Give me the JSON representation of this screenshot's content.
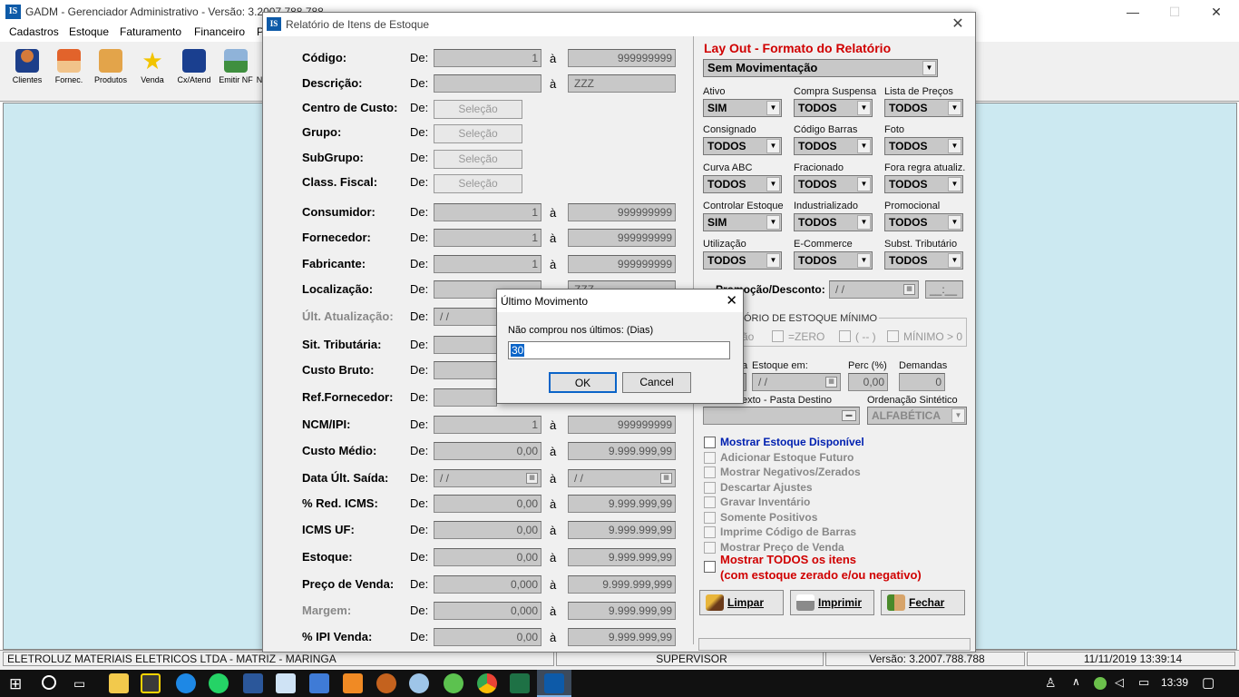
{
  "app": {
    "title": "GADM - Gerenciador Administrativo - Versão: 3.2007.788.788",
    "logo": "IS"
  },
  "menus": [
    "Cadastros",
    "Estoque",
    "Faturamento",
    "Financeiro",
    "P"
  ],
  "toolbar": [
    {
      "label": "Clientes",
      "icon": "person-icon"
    },
    {
      "label": "Fornec.",
      "icon": "house-icon"
    },
    {
      "label": "Produtos",
      "icon": "box-icon"
    },
    {
      "label": "Venda",
      "icon": "star-icon"
    },
    {
      "label": "Cx/Atend",
      "icon": "cash-icon"
    },
    {
      "label": "Emitir NF",
      "icon": "printer-icon"
    },
    {
      "label": "N",
      "icon": "partial-icon"
    }
  ],
  "statusbar": {
    "company": "ELETROLUZ MATERIAIS ELETRICOS LTDA  -  MATRIZ - MARINGA",
    "user": "SUPERVISOR",
    "version": "Versão: 3.2007.788.788",
    "datetime": "11/11/2019 13:39:14"
  },
  "report": {
    "title": "Relatório de Itens de Estoque",
    "logo": "IS",
    "de": "De:",
    "a": "à",
    "select_label": "Seleção",
    "codigo": {
      "label": "Código:",
      "from": "1",
      "to": "999999999"
    },
    "descricao": {
      "label": "Descrição:",
      "from": "",
      "to": "ZZZ"
    },
    "centro": {
      "label": "Centro de Custo:"
    },
    "grupo": {
      "label": "Grupo:"
    },
    "subgrupo": {
      "label": "SubGrupo:"
    },
    "classfiscal": {
      "label": "Class. Fiscal:"
    },
    "consumidor": {
      "label": "Consumidor:",
      "from": "1",
      "to": "999999999"
    },
    "fornecedor": {
      "label": "Fornecedor:",
      "from": "1",
      "to": "999999999"
    },
    "fabricante": {
      "label": "Fabricante:",
      "from": "1",
      "to": "999999999"
    },
    "localizacao": {
      "label": "Localização:",
      "to": "ZZZ"
    },
    "ultatual": {
      "label": "Últ. Atualização:",
      "from": "/  /"
    },
    "sittrib": {
      "label": "Sit. Tributária:"
    },
    "custobruto": {
      "label": "Custo Bruto:"
    },
    "reffornec": {
      "label": "Ref.Fornecedor:"
    },
    "ncm": {
      "label": "NCM/IPI:",
      "from": "1",
      "to": "999999999"
    },
    "customedio": {
      "label": "Custo Médio:",
      "from": "0,00",
      "to": "9.999.999,99"
    },
    "dataultsaida": {
      "label": "Data Últ. Saída:",
      "from": "/  /",
      "to": "/  /"
    },
    "redicms": {
      "label": "% Red. ICMS:",
      "from": "0,00",
      "to": "9.999.999,99"
    },
    "icmsuf": {
      "label": "ICMS UF:",
      "from": "0,00",
      "to": "9.999.999,99"
    },
    "estoque": {
      "label": "Estoque:",
      "from": "0,00",
      "to": "9.999.999,99"
    },
    "precovenda": {
      "label": "Preço de Venda:",
      "from": "0,000",
      "to": "9.999.999,999"
    },
    "margem": {
      "label": "Margem:",
      "from": "0,000",
      "to": "9.999.999,99"
    },
    "ipivenda": {
      "label": "% IPI Venda:",
      "from": "0,00",
      "to": "9.999.999,99"
    },
    "layout": {
      "title": "Lay Out - Formato do Relatório",
      "value": "Sem Movimentação"
    },
    "filters": [
      {
        "label": "Ativo",
        "value": "SIM"
      },
      {
        "label": "Compra Suspensa",
        "value": "TODOS"
      },
      {
        "label": "Lista de Preços",
        "value": "TODOS"
      },
      {
        "label": "Consignado",
        "value": "TODOS"
      },
      {
        "label": "Código Barras",
        "value": "TODOS"
      },
      {
        "label": "Foto",
        "value": "TODOS"
      },
      {
        "label": "Curva ABC",
        "value": "TODOS"
      },
      {
        "label": "Fracionado",
        "value": "TODOS"
      },
      {
        "label": "Fora regra atualiz.",
        "value": "TODOS"
      },
      {
        "label": "Controlar Estoque",
        "value": "SIM"
      },
      {
        "label": "Industrializado",
        "value": "TODOS"
      },
      {
        "label": "Promocional",
        "value": "TODOS"
      },
      {
        "label": "Utilização",
        "value": "TODOS"
      },
      {
        "label": "E-Commerce",
        "value": "TODOS"
      },
      {
        "label": "Subst. Tributário",
        "value": "TODOS"
      }
    ],
    "promocao": {
      "label": "Promoção/Desconto:",
      "date": "/  /",
      "time": "__:__"
    },
    "estmin": {
      "title": "ÓRIO DE ESTOQUE MÍNIMO",
      "opt0": "ão",
      "opt1": "=ZERO",
      "opt2": "( -- )",
      "opt3": "MÍNIMO > 0"
    },
    "estoque_em": {
      "prefix": "a",
      "label": "Estoque em:",
      "date": "/  /"
    },
    "perc": {
      "label": "Perc (%)",
      "value": "0,00"
    },
    "demandas": {
      "label": "Demandas",
      "value": "0"
    },
    "pasta": {
      "label": "exto - Pasta Destino"
    },
    "ordenacao": {
      "label": "Ordenação Sintético",
      "value": "ALFABÉTICA"
    },
    "checks": [
      "Mostrar Estoque Disponível",
      "Adicionar Estoque Futuro",
      "Mostrar Negativos/Zerados",
      "Descartar Ajustes",
      "Gravar Inventário",
      "Somente Positivos",
      "Imprime Código de Barras",
      "Mostrar Preço de Venda"
    ],
    "todos": {
      "line1": "Mostrar TODOS os itens",
      "line2": "(com estoque zerado e/ou negativo)"
    },
    "btn_limpar": "Limpar",
    "btn_imprimir": "Imprimir",
    "btn_fechar": "Fechar"
  },
  "modal": {
    "title": "Último Movimento",
    "prompt": "Não comprou nos últimos: (Dias)",
    "value": "30",
    "ok": "OK",
    "cancel": "Cancel"
  },
  "taskbar": {
    "time": "13:39"
  }
}
